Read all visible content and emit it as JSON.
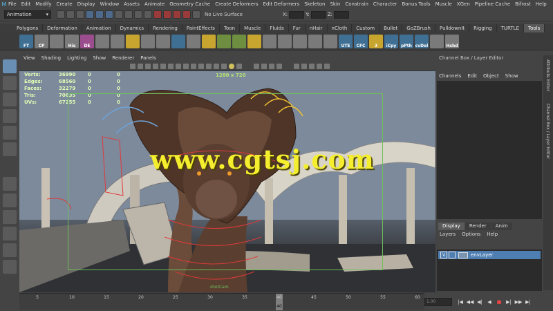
{
  "menubar": {
    "items": [
      "File",
      "Edit",
      "Modify",
      "Create",
      "Display",
      "Window",
      "Assets",
      "Animate",
      "Geometry Cache",
      "Create Deformers",
      "Edit Deformers",
      "Skeleton",
      "Skin",
      "Constrain",
      "Character",
      "Bonus Tools",
      "Muscle",
      "XGen",
      "Pipeline Cache",
      "Bifrost",
      "Help"
    ]
  },
  "statusline": {
    "mode": "Animation",
    "live_surface": "No Live Surface",
    "x_label": "X:",
    "y_label": "Y:",
    "z_label": "Z:"
  },
  "shelf": {
    "tabs": [
      "Polygons",
      "Deformation",
      "Animation",
      "Dynamics",
      "Rendering",
      "PaintEffects",
      "Toon",
      "Muscle",
      "Fluids",
      "Fur",
      "nHair",
      "nCloth",
      "Custom",
      "Bullet",
      "GoZBrush",
      "PulldownIt",
      "Rigging",
      "TURTLE",
      "Tools"
    ],
    "active_tab": "Tools",
    "tools": [
      {
        "label": "FT",
        "color": "bl"
      },
      {
        "label": "CP",
        "color": "gr"
      },
      {
        "label": "",
        "color": "gr"
      },
      {
        "label": "His",
        "color": "gr"
      },
      {
        "label": "DE",
        "color": "pk"
      },
      {
        "label": "",
        "color": "gr"
      },
      {
        "label": "",
        "color": "gr"
      },
      {
        "label": "",
        "color": "y"
      },
      {
        "label": "",
        "color": "gr"
      },
      {
        "label": "",
        "color": "gr"
      },
      {
        "label": "",
        "color": "bl"
      },
      {
        "label": "",
        "color": "gr"
      },
      {
        "label": "",
        "color": "y"
      },
      {
        "label": "",
        "color": "g"
      },
      {
        "label": "",
        "color": "g"
      },
      {
        "label": "",
        "color": "y"
      },
      {
        "label": "",
        "color": "gr"
      },
      {
        "label": "",
        "color": "gr"
      },
      {
        "label": "",
        "color": "gr"
      },
      {
        "label": "",
        "color": "gr"
      },
      {
        "label": "",
        "color": "gr"
      },
      {
        "label": "UTE",
        "color": "bl"
      },
      {
        "label": "CFC",
        "color": "bl"
      },
      {
        "label": "3",
        "color": "y"
      },
      {
        "label": "iCpy",
        "color": "bl"
      },
      {
        "label": "pPth",
        "color": "bl"
      },
      {
        "label": "cvDel",
        "color": "bl"
      },
      {
        "label": "",
        "color": "gr"
      },
      {
        "label": "Hshd",
        "color": "gr"
      }
    ]
  },
  "viewport": {
    "menu": [
      "View",
      "Shading",
      "Lighting",
      "Show",
      "Renderer",
      "Panels"
    ],
    "hud": [
      {
        "label": "Verts:",
        "v1": "36990",
        "v2": "0",
        "v3": "0"
      },
      {
        "label": "Edges:",
        "v1": "68560",
        "v2": "0",
        "v3": "0"
      },
      {
        "label": "Faces:",
        "v1": "32279",
        "v1b": "",
        "v2": "0",
        "v3": "0"
      },
      {
        "label": "Tris:",
        "v1": "70635",
        "v2": "0",
        "v3": "0"
      },
      {
        "label": "UVs:",
        "v1": "67255",
        "v2": "0",
        "v3": "0"
      }
    ],
    "resolution": "1280 x 720",
    "camera": "shotCam",
    "watermark": "www.cgtsj.com"
  },
  "channel_box": {
    "title": "Channel Box / Layer Editor",
    "menu": [
      "Channels",
      "Edit",
      "Object",
      "Show"
    ]
  },
  "side_tabs": [
    "Attribute Editor",
    "Channel Box / Layer Editor"
  ],
  "layer_editor": {
    "tabs": [
      "Display",
      "Render",
      "Anim"
    ],
    "active_tab": "Display",
    "menu": [
      "Layers",
      "Options",
      "Help"
    ],
    "layer": {
      "visible": "V",
      "name": "envLayer"
    }
  },
  "timeline": {
    "ticks": [
      "5",
      "10",
      "15",
      "20",
      "25",
      "30",
      "35",
      "40",
      "45",
      "50",
      "55",
      "60"
    ],
    "current": "40",
    "frame_field": "1.00",
    "buttons": [
      "|◀",
      "◀◀",
      "◀|",
      "◀",
      "■",
      "▶|",
      "▶▶",
      "▶|"
    ]
  },
  "colors": {
    "accent": "#f4ee2e",
    "layer_highlight": "#4f7fb2",
    "gate": "#6ec05c",
    "hud": "#e2ffb5"
  }
}
